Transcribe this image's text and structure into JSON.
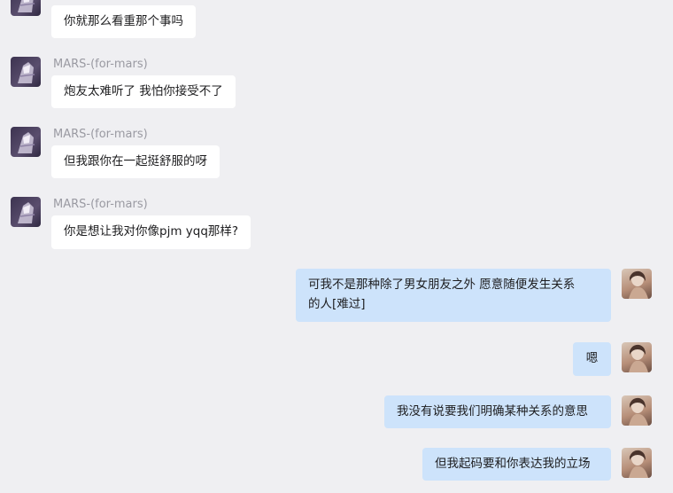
{
  "messages": [
    {
      "side": "left",
      "sender": "",
      "text": "你就那么看重那个事吗"
    },
    {
      "side": "left",
      "sender": "MARS-(for-mars)",
      "text": "炮友太难听了 我怕你接受不了"
    },
    {
      "side": "left",
      "sender": "MARS-(for-mars)",
      "text": "但我跟你在一起挺舒服的呀"
    },
    {
      "side": "left",
      "sender": "MARS-(for-mars)",
      "text": "你是想让我对你像pjm yqq那样?"
    },
    {
      "side": "right",
      "lines": [
        "可我不是那种除了男女朋友之外 愿意随便发生关系",
        "的人[难过]"
      ]
    },
    {
      "side": "right",
      "text": "嗯"
    },
    {
      "side": "right",
      "text": "我没有说要我们明确某种关系的意思"
    },
    {
      "side": "right",
      "text": "但我起码要和你表达我的立场"
    }
  ],
  "colors": {
    "background": "#efeff2",
    "left_bubble": "#ffffff",
    "right_bubble": "#cde3fb",
    "sender_name": "#9a9aa2"
  },
  "icons": {
    "left_avatar": "anime-character-avatar-icon",
    "right_avatar": "user-photo-avatar-icon"
  }
}
